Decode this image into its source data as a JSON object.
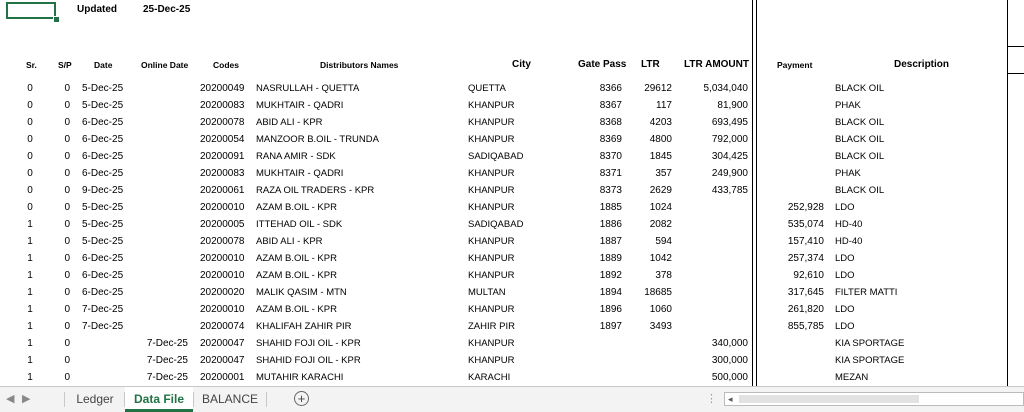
{
  "sheet": {
    "updated_label": "Updated",
    "updated_date": "25-Dec-25",
    "headers": {
      "sr": "Sr.",
      "sp": "S/P",
      "date": "Date",
      "online_date": "Online Date",
      "codes": "Codes",
      "distributors": "Distributors Names",
      "city": "City",
      "gate_pass": "Gate Pass",
      "ltr": "LTR",
      "ltr_amount": "LTR AMOUNT",
      "payment": "Payment",
      "description": "Description"
    },
    "rows": [
      {
        "sr": "0",
        "sp": "0",
        "date": "5-Dec-25",
        "online": "",
        "code": "20200049",
        "name": "NASRULLAH - QUETTA",
        "city": "QUETTA",
        "gate": "8366",
        "ltr": "29612",
        "amount": "5,034,040",
        "payment": "",
        "desc": "BLACK OIL"
      },
      {
        "sr": "0",
        "sp": "0",
        "date": "5-Dec-25",
        "online": "",
        "code": "20200083",
        "name": "MUKHTAIR - QADRI",
        "city": "KHANPUR",
        "gate": "8367",
        "ltr": "117",
        "amount": "81,900",
        "payment": "",
        "desc": "PHAK"
      },
      {
        "sr": "0",
        "sp": "0",
        "date": "6-Dec-25",
        "online": "",
        "code": "20200078",
        "name": "ABID ALI - KPR",
        "city": "KHANPUR",
        "gate": "8368",
        "ltr": "4203",
        "amount": "693,495",
        "payment": "",
        "desc": "BLACK OIL"
      },
      {
        "sr": "0",
        "sp": "0",
        "date": "6-Dec-25",
        "online": "",
        "code": "20200054",
        "name": "MANZOOR B.OIL - TRUNDA",
        "city": "KHANPUR",
        "gate": "8369",
        "ltr": "4800",
        "amount": "792,000",
        "payment": "",
        "desc": "BLACK OIL"
      },
      {
        "sr": "0",
        "sp": "0",
        "date": "6-Dec-25",
        "online": "",
        "code": "20200091",
        "name": "RANA AMIR - SDK",
        "city": "SADIQABAD",
        "gate": "8370",
        "ltr": "1845",
        "amount": "304,425",
        "payment": "",
        "desc": "BLACK OIL"
      },
      {
        "sr": "0",
        "sp": "0",
        "date": "6-Dec-25",
        "online": "",
        "code": "20200083",
        "name": "MUKHTAIR - QADRI",
        "city": "KHANPUR",
        "gate": "8371",
        "ltr": "357",
        "amount": "249,900",
        "payment": "",
        "desc": "PHAK"
      },
      {
        "sr": "0",
        "sp": "0",
        "date": "9-Dec-25",
        "online": "",
        "code": "20200061",
        "name": "RAZA OIL TRADERS - KPR",
        "city": "KHANPUR",
        "gate": "8373",
        "ltr": "2629",
        "amount": "433,785",
        "payment": "",
        "desc": "BLACK OIL"
      },
      {
        "sr": "0",
        "sp": "0",
        "date": "5-Dec-25",
        "online": "",
        "code": "20200010",
        "name": "AZAM B.OIL - KPR",
        "city": "KHANPUR",
        "gate": "1885",
        "ltr": "1024",
        "amount": "",
        "payment": "252,928",
        "desc": "LDO"
      },
      {
        "sr": "1",
        "sp": "0",
        "date": "5-Dec-25",
        "online": "",
        "code": "20200005",
        "name": "ITTEHAD OIL - SDK",
        "city": "SADIQABAD",
        "gate": "1886",
        "ltr": "2082",
        "amount": "",
        "payment": "535,074",
        "desc": "HD-40"
      },
      {
        "sr": "1",
        "sp": "0",
        "date": "5-Dec-25",
        "online": "",
        "code": "20200078",
        "name": "ABID ALI - KPR",
        "city": "KHANPUR",
        "gate": "1887",
        "ltr": "594",
        "amount": "",
        "payment": "157,410",
        "desc": "HD-40"
      },
      {
        "sr": "1",
        "sp": "0",
        "date": "6-Dec-25",
        "online": "",
        "code": "20200010",
        "name": "AZAM B.OIL - KPR",
        "city": "KHANPUR",
        "gate": "1889",
        "ltr": "1042",
        "amount": "",
        "payment": "257,374",
        "desc": "LDO"
      },
      {
        "sr": "1",
        "sp": "0",
        "date": "6-Dec-25",
        "online": "",
        "code": "20200010",
        "name": "AZAM B.OIL - KPR",
        "city": "KHANPUR",
        "gate": "1892",
        "ltr": "378",
        "amount": "",
        "payment": "92,610",
        "desc": "LDO"
      },
      {
        "sr": "1",
        "sp": "0",
        "date": "6-Dec-25",
        "online": "",
        "code": "20200020",
        "name": "MALIK QASIM - MTN",
        "city": "MULTAN",
        "gate": "1894",
        "ltr": "18685",
        "amount": "",
        "payment": "317,645",
        "desc": "FILTER MATTI"
      },
      {
        "sr": "1",
        "sp": "0",
        "date": "7-Dec-25",
        "online": "",
        "code": "20200010",
        "name": "AZAM B.OIL - KPR",
        "city": "KHANPUR",
        "gate": "1896",
        "ltr": "1060",
        "amount": "",
        "payment": "261,820",
        "desc": "LDO"
      },
      {
        "sr": "1",
        "sp": "0",
        "date": "7-Dec-25",
        "online": "",
        "code": "20200074",
        "name": "KHALIFAH ZAHIR PIR",
        "city": "ZAHIR PIR",
        "gate": "1897",
        "ltr": "3493",
        "amount": "",
        "payment": "855,785",
        "desc": "LDO"
      },
      {
        "sr": "1",
        "sp": "0",
        "date": "",
        "online": "7-Dec-25",
        "code": "20200047",
        "name": "SHAHID FOJI OIL - KPR",
        "city": "KHANPUR",
        "gate": "",
        "ltr": "",
        "amount": "340,000",
        "payment": "",
        "desc": "KIA SPORTAGE"
      },
      {
        "sr": "1",
        "sp": "0",
        "date": "",
        "online": "7-Dec-25",
        "code": "20200047",
        "name": "SHAHID FOJI OIL - KPR",
        "city": "KHANPUR",
        "gate": "",
        "ltr": "",
        "amount": "300,000",
        "payment": "",
        "desc": "KIA SPORTAGE"
      },
      {
        "sr": "1",
        "sp": "0",
        "date": "",
        "online": "7-Dec-25",
        "code": "20200001",
        "name": "MUTAHIR KARACHI",
        "city": "KARACHI",
        "gate": "",
        "ltr": "",
        "amount": "500,000",
        "payment": "",
        "desc": "MEZAN"
      }
    ]
  },
  "tabs": {
    "ledger": "Ledger",
    "data_file": "Data File",
    "balance": "BALANCE",
    "add_symbol": "+",
    "prev_symbol": "◀",
    "next_symbol": "▶",
    "more_symbol": "⋮",
    "scroll_left_symbol": "◂"
  },
  "colors": {
    "accent": "#217346",
    "tabbar_bg": "#f3f3f3"
  }
}
